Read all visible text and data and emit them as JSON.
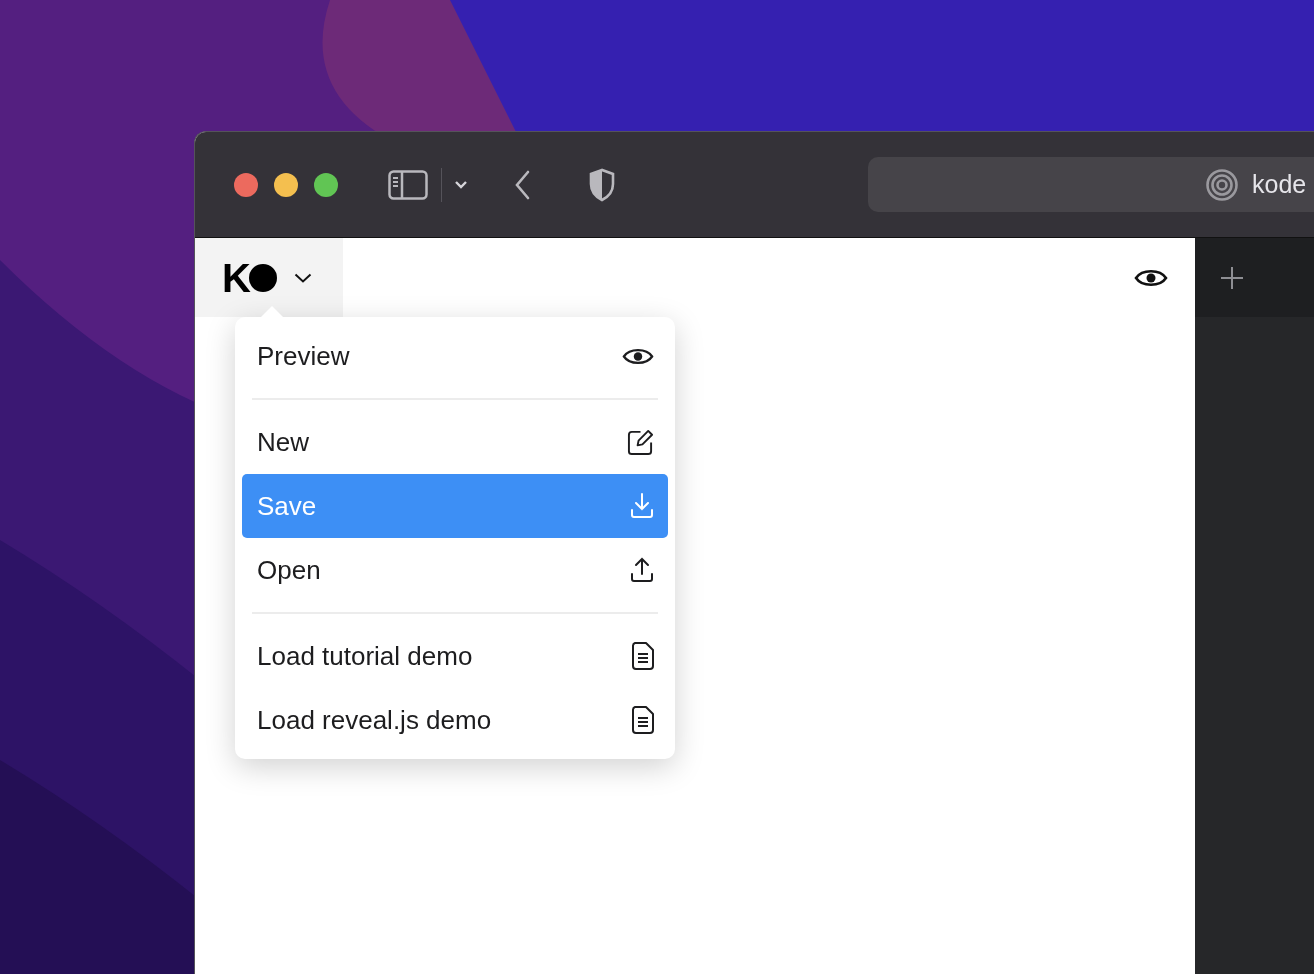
{
  "browser": {
    "address": "kode"
  },
  "app": {
    "logo": "K"
  },
  "menu": {
    "groups": [
      [
        {
          "label": "Preview",
          "kind": "preview",
          "selected": false
        }
      ],
      [
        {
          "label": "New",
          "kind": "new",
          "selected": false
        },
        {
          "label": "Save",
          "kind": "save",
          "selected": true
        },
        {
          "label": "Open",
          "kind": "open",
          "selected": false
        }
      ],
      [
        {
          "label": "Load tutorial demo",
          "kind": "document",
          "selected": false
        },
        {
          "label": "Load reveal.js demo",
          "kind": "document",
          "selected": false
        }
      ]
    ]
  }
}
